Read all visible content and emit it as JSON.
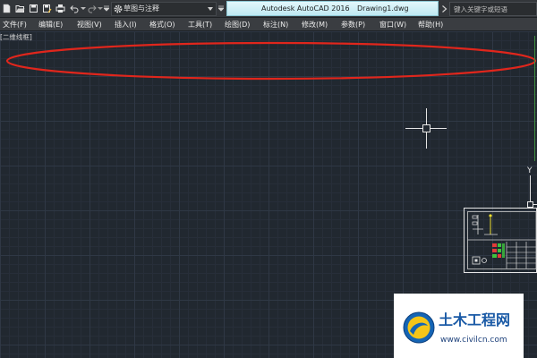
{
  "app": {
    "title": "Autodesk AutoCAD 2016",
    "document": "Drawing1.dwg"
  },
  "quick_access": {
    "icons": [
      "new-icon",
      "open-icon",
      "save-icon",
      "save-as-icon",
      "print-icon",
      "undo-icon",
      "redo-icon",
      "customize-icon",
      "gear-icon",
      "chevron-right-icon"
    ],
    "workspace": "草图与注释"
  },
  "search": {
    "placeholder": "键入关键字或短语"
  },
  "menu": {
    "items": [
      "文件(F)",
      "编辑(E)",
      "视图(V)",
      "插入(I)",
      "格式(O)",
      "工具(T)",
      "绘图(D)",
      "标注(N)",
      "修改(M)",
      "参数(P)",
      "窗口(W)",
      "帮助(H)"
    ]
  },
  "viewport": {
    "label": "[二维线框]"
  },
  "ucs": {
    "y_label": "Y"
  },
  "watermark": {
    "name": "土木工程网",
    "url": "www.civilcn.com"
  },
  "colors": {
    "canvas_bg": "#212830",
    "title_bg": "#c9eff7",
    "annotation_red": "#e0261c",
    "watermark_blue": "#1a5aa6"
  }
}
